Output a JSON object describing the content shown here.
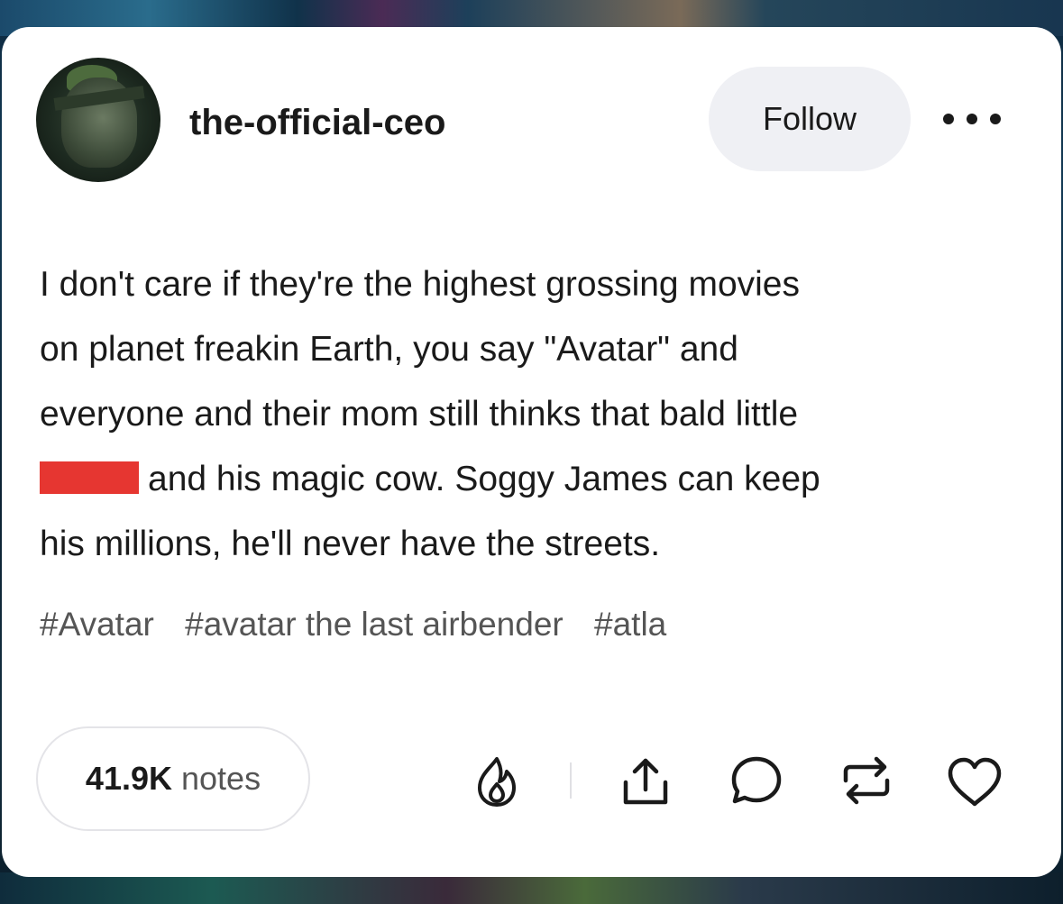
{
  "post": {
    "username": "the-official-ceo",
    "follow_label": "Follow",
    "more_label": "More options",
    "body_lines": [
      "I don't care if they're the highest grossing movies",
      "on planet freakin Earth, you say \"Avatar\" and",
      "everyone and their mom still thinks that bald little",
      "and his magic cow. Soggy James can keep",
      "his millions, he'll never have the streets."
    ],
    "tags": [
      "#Avatar",
      "#avatar the last airbender",
      "#atla"
    ],
    "notes_count": "41.9K",
    "notes_label": "notes",
    "actions": [
      "blaze-icon",
      "share-icon",
      "reply-icon",
      "reblog-icon",
      "like-icon"
    ]
  },
  "colors": {
    "card_bg": "#ffffff",
    "follow_bg": "#eff0f4",
    "redaction": "#e63631",
    "text": "#1a1a1a",
    "muted_text": "#555555"
  }
}
